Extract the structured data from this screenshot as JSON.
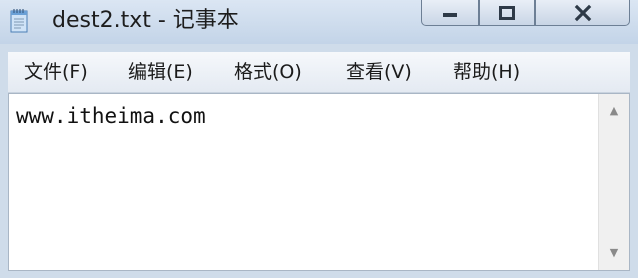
{
  "window": {
    "title": "dest2.txt - 记事本",
    "icon": "notepad-icon",
    "controls": {
      "minimize_icon": "minimize-icon",
      "maximize_icon": "maximize-icon",
      "close_icon": "close-icon"
    }
  },
  "menubar": {
    "items": [
      {
        "label": "文件(F)"
      },
      {
        "label": "编辑(E)"
      },
      {
        "label": "格式(O)"
      },
      {
        "label": "查看(V)"
      },
      {
        "label": "帮助(H)"
      }
    ]
  },
  "editor": {
    "content": "www.itheima.com"
  },
  "scrollbar": {
    "up_icon": "scroll-up-arrow-icon",
    "down_icon": "scroll-down-arrow-icon"
  }
}
